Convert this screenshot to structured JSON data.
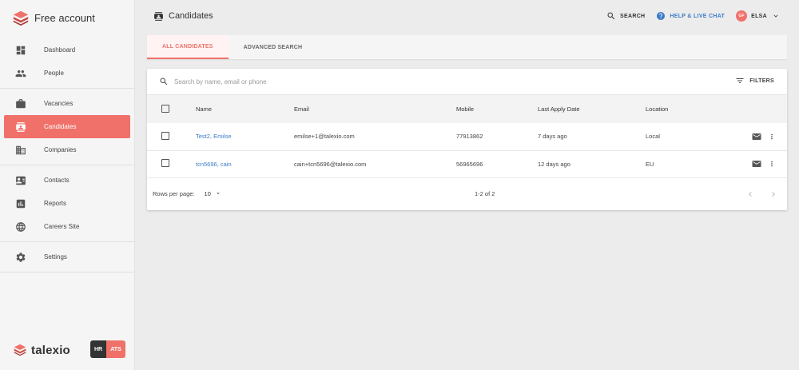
{
  "brand": {
    "title": "Free account"
  },
  "sidebar": {
    "groups": [
      [
        {
          "label": "Dashboard",
          "icon": "dashboard-icon"
        },
        {
          "label": "People",
          "icon": "people-icon"
        }
      ],
      [
        {
          "label": "Vacancies",
          "icon": "briefcase-icon"
        },
        {
          "label": "Candidates",
          "icon": "candidate-icon",
          "active": true
        },
        {
          "label": "Companies",
          "icon": "building-icon"
        }
      ],
      [
        {
          "label": "Contacts",
          "icon": "contact-card-icon"
        },
        {
          "label": "Reports",
          "icon": "chart-icon"
        },
        {
          "label": "Careers Site",
          "icon": "globe-icon"
        }
      ],
      [
        {
          "label": "Settings",
          "icon": "gear-icon"
        }
      ]
    ],
    "footer": {
      "logo_text": "talexio",
      "badge_left": "HR",
      "badge_right": "ATS"
    }
  },
  "header": {
    "title": "Candidates",
    "search_label": "SEARCH",
    "help_label": "HELP & LIVE CHAT",
    "user_initials": "GF",
    "user_name": "ELSA"
  },
  "tabs": [
    {
      "label": "ALL CANDIDATES",
      "active": true
    },
    {
      "label": "ADVANCED SEARCH",
      "active": false
    }
  ],
  "search": {
    "placeholder": "Search by name, email or phone",
    "value": ""
  },
  "filters_label": "FILTERS",
  "table": {
    "columns": [
      "Name",
      "Email",
      "Mobile",
      "Last Apply Date",
      "Location"
    ],
    "rows": [
      {
        "name": "Test2, Emilse",
        "email": "emilse+1@talexio.com",
        "mobile": "77913862",
        "last_apply": "7 days ago",
        "location": "Local"
      },
      {
        "name": "tcn5696, cain",
        "email": "cain+tcn5696@talexio.com",
        "mobile": "56965696",
        "last_apply": "12 days ago",
        "location": "EU"
      }
    ]
  },
  "pagination": {
    "rows_per_page_label": "Rows per page:",
    "rows_per_page": "10",
    "range": "1-2 of 2"
  },
  "colors": {
    "accent": "#f0716a",
    "link": "#3b7bc9"
  }
}
